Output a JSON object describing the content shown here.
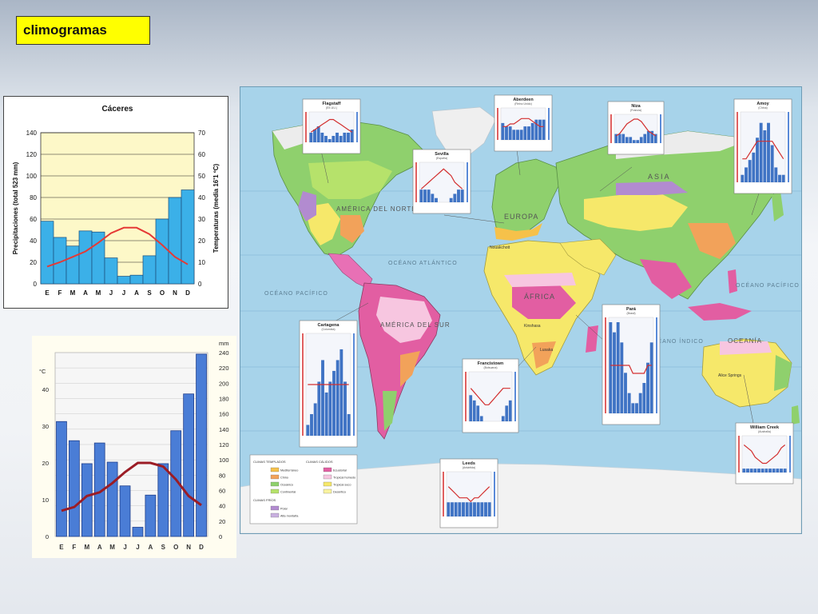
{
  "title": "climogramas",
  "chart_data": [
    {
      "type": "bar",
      "title": "Cáceres",
      "categories": [
        "E",
        "F",
        "M",
        "A",
        "M",
        "J",
        "J",
        "A",
        "S",
        "O",
        "N",
        "D"
      ],
      "series": [
        {
          "name": "Precipitaciones",
          "type": "bar",
          "values": [
            58,
            43,
            35,
            49,
            48,
            24,
            7,
            8,
            26,
            60,
            80,
            87
          ]
        },
        {
          "name": "Temperaturas",
          "type": "line",
          "values": [
            8,
            10,
            12.5,
            15,
            19,
            23.5,
            26,
            26,
            23,
            18,
            12.5,
            9
          ]
        }
      ],
      "ylabel": "Precipitaciones (total 523 mm)",
      "y2label": "Temperaturas (media 16'1 ºC)",
      "ylim": [
        0,
        140
      ],
      "y2lim": [
        0,
        70
      ],
      "yticks": [
        0,
        20,
        40,
        60,
        80,
        100,
        120,
        140
      ],
      "y2ticks": [
        0,
        10,
        20,
        30,
        40,
        50,
        60,
        70
      ],
      "colors": {
        "bars": "#3bb0e8",
        "line": "#e53935",
        "plot_bg": "#fdf8c8"
      },
      "grid": true
    },
    {
      "type": "bar",
      "categories": [
        "E",
        "F",
        "M",
        "A",
        "M",
        "J",
        "J",
        "A",
        "S",
        "O",
        "N",
        "D"
      ],
      "series": [
        {
          "name": "",
          "type": "bar",
          "values": [
            150,
            125,
            95,
            122,
            97,
            66,
            12,
            54,
            95,
            138,
            186,
            238
          ]
        },
        {
          "name": "",
          "type": "line",
          "values": [
            7,
            8,
            11,
            12,
            14.5,
            17.5,
            20,
            20,
            19,
            15.5,
            11,
            8.5
          ]
        }
      ],
      "y_right_unit": "mm",
      "y_left_unit": "°C",
      "ylim": [
        0,
        240
      ],
      "y2lim": [
        0,
        50
      ],
      "yticks": [
        0,
        20,
        40,
        60,
        80,
        100,
        120,
        140,
        160,
        180,
        200,
        220,
        240
      ],
      "y2ticks": [
        0,
        10,
        20,
        30,
        40
      ],
      "colors": {
        "bars": "#4a7dd6",
        "line": "#9b1c25",
        "plot_bg": "#f6f6f6"
      },
      "grid": true
    }
  ],
  "map": {
    "labels": {
      "america_norte": "AMÉRICA DEL NORTE",
      "america_sur": "AMÉRICA DEL SUR",
      "europa": "EUROPA",
      "africa": "ÁFRICA",
      "asia": "ASIA",
      "oceania": "OCEANÍA",
      "oceano_atlantico": "OCÉANO ATLÁNTICO",
      "oceano_pacifico": "OCÉANO PACÍFICO",
      "oceano_indico": "OCÉANO ÍNDICO",
      "oceano_pacifico_e": "OCÉANO PACÍFICO"
    },
    "mini_climograms": [
      {
        "name": "Flagstaff",
        "sub": "(EE.UU.)"
      },
      {
        "name": "Aberdeen",
        "sub": "(Reino Unido)"
      },
      {
        "name": "Niza",
        "sub": "(Francia)"
      },
      {
        "name": "Amoy",
        "sub": "(China)"
      },
      {
        "name": "Sevilla",
        "sub": "(España)"
      },
      {
        "name": "Cartagena",
        "sub": "(Colombia)"
      },
      {
        "name": "Francistown",
        "sub": "(Botsuana)"
      },
      {
        "name": "Pará",
        "sub": "(Brasil)"
      },
      {
        "name": "William Creek",
        "sub": "(Australia)"
      },
      {
        "name": "Leeds",
        "sub": "(Antártida)"
      }
    ],
    "legend": {
      "group1": "CLIMAS TEMPLADOS",
      "group2": "CLIMAS CÁLIDOS",
      "group3": "CLIMAS FRÍOS",
      "items": [
        "Mediterráneo",
        "Chino",
        "Oceánico",
        "Continental",
        "Ecuatorial",
        "Tropical húmedo",
        "Tropical seco",
        "Desértico",
        "Polar",
        "Alta montaña"
      ]
    },
    "places": {
      "nouakchott": "Nouakchott",
      "alice": "Alice Springs",
      "kinshasa": "Kinshasa",
      "lusaka": "Lusaka"
    }
  }
}
